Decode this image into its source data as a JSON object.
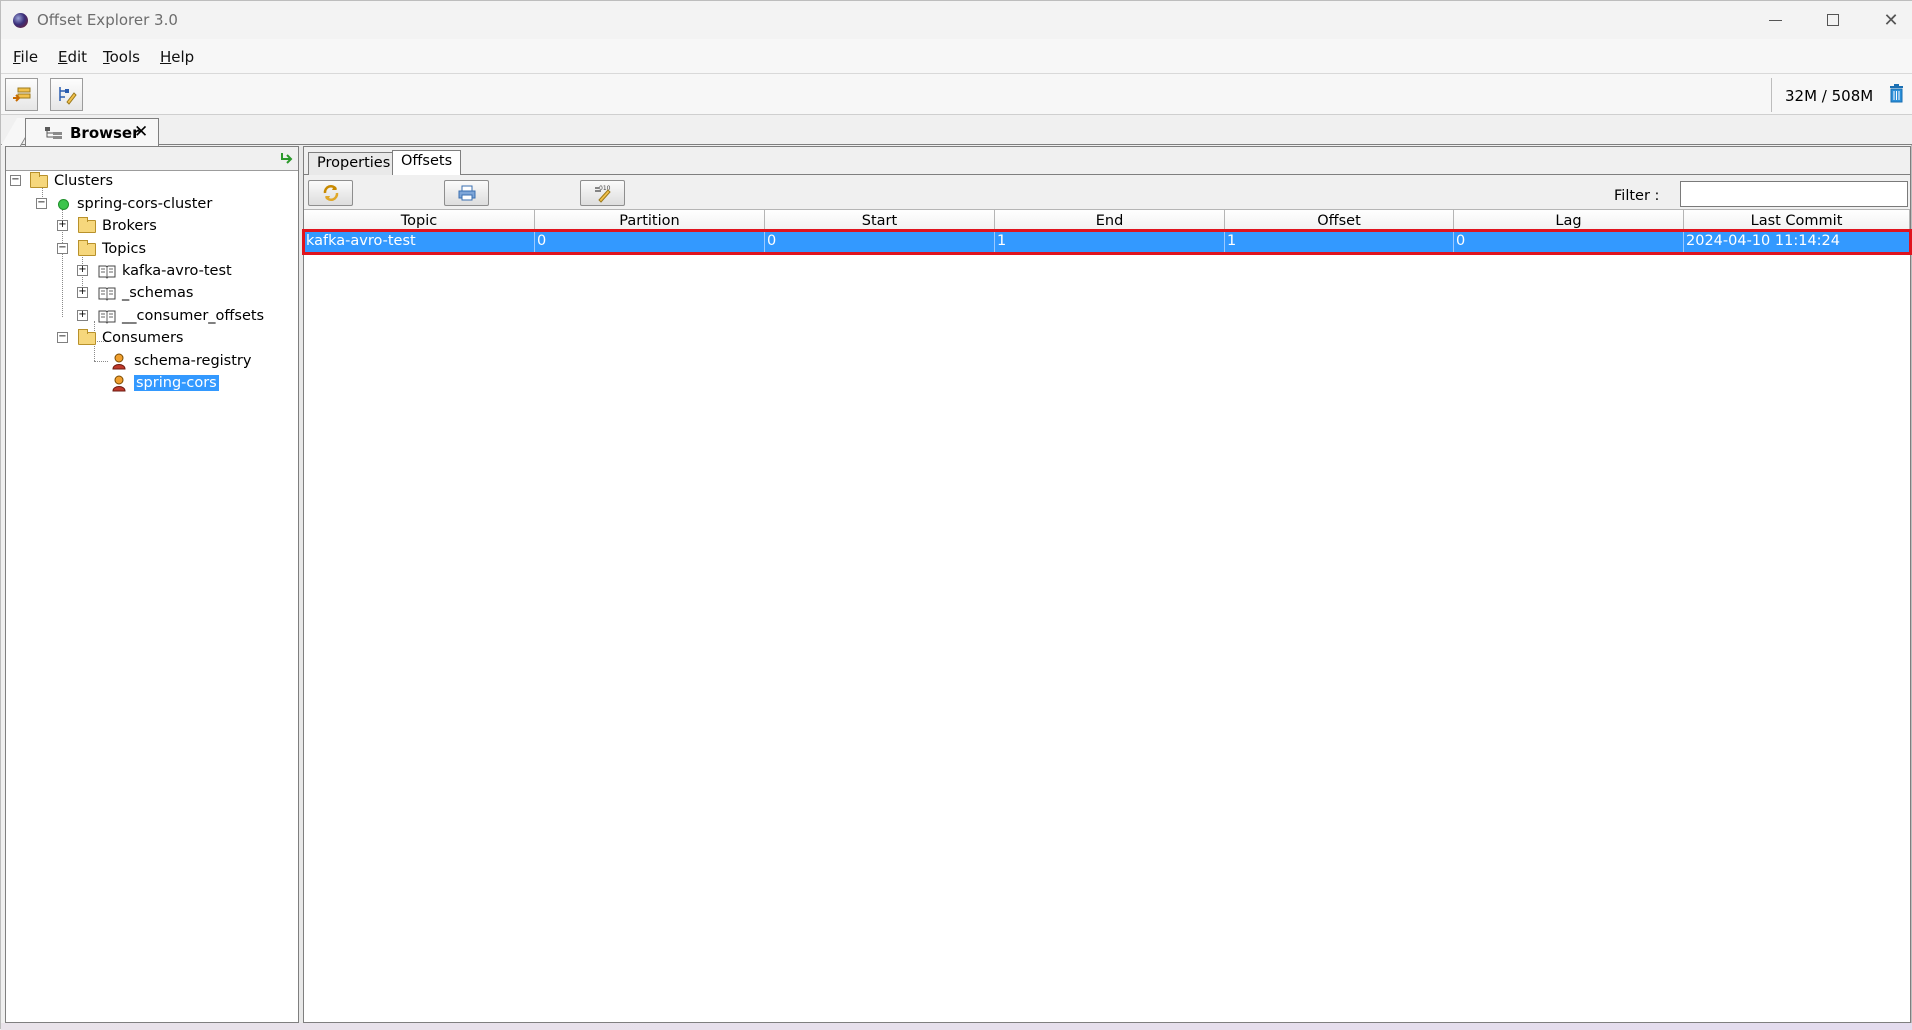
{
  "window": {
    "title": "Offset Explorer  3.0"
  },
  "menu": {
    "items": [
      {
        "accel": "F",
        "rest": "ile"
      },
      {
        "accel": "E",
        "rest": "dit"
      },
      {
        "accel": "T",
        "rest": "ools"
      },
      {
        "accel": "H",
        "rest": "elp"
      }
    ]
  },
  "toolbar": {
    "memory": "32M / 508M"
  },
  "browser_tab": {
    "label": "Browser",
    "close": "✕"
  },
  "tree": {
    "clusters": "Clusters",
    "cluster_name": "spring-cors-cluster",
    "brokers": "Brokers",
    "topics": "Topics",
    "topic_items": [
      "kafka-avro-test",
      "_schemas",
      "__consumer_offsets"
    ],
    "consumers": "Consumers",
    "consumer_items": [
      "schema-registry",
      "spring-cors"
    ],
    "selected": "spring-cors"
  },
  "subtabs": {
    "properties": "Properties",
    "offsets": "Offsets"
  },
  "filter": {
    "label": "Filter :",
    "value": ""
  },
  "table": {
    "columns": [
      "Topic",
      "Partition",
      "Start",
      "End",
      "Offset",
      "Lag",
      "Last Commit"
    ],
    "rows": [
      [
        "kafka-avro-test",
        "0",
        "0",
        "1",
        "1",
        "0",
        "2024-04-10 11:14:24"
      ]
    ]
  },
  "colors": {
    "selection": "#3399ff",
    "highlight": "#e0141e"
  }
}
